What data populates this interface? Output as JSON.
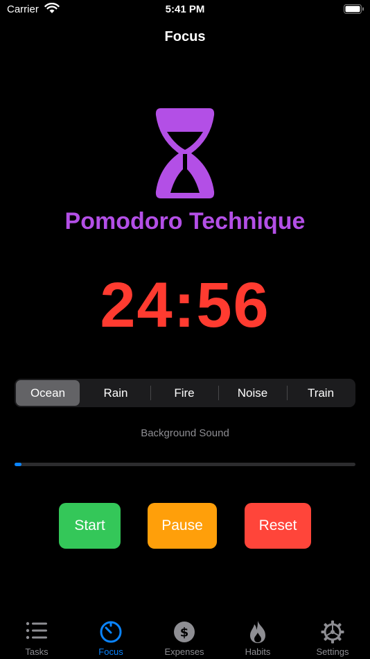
{
  "status_bar": {
    "carrier": "Carrier",
    "time": "5:41 PM"
  },
  "nav": {
    "title": "Focus"
  },
  "main": {
    "icon": "hourglass-icon",
    "technique_title": "Pomodoro Technique",
    "timer": "24:56",
    "sound_segments": [
      "Ocean",
      "Rain",
      "Fire",
      "Noise",
      "Train"
    ],
    "selected_sound": "Ocean",
    "sound_label": "Background Sound",
    "sound_progress": 0.02
  },
  "controls": {
    "start": "Start",
    "pause": "Pause",
    "reset": "Reset"
  },
  "tab_bar": {
    "items": [
      {
        "label": "Tasks",
        "icon": "list-icon",
        "active": false
      },
      {
        "label": "Focus",
        "icon": "timer-icon",
        "active": true
      },
      {
        "label": "Expenses",
        "icon": "dollar-icon",
        "active": false
      },
      {
        "label": "Habits",
        "icon": "flame-icon",
        "active": false
      },
      {
        "label": "Settings",
        "icon": "gear-icon",
        "active": false
      }
    ]
  },
  "colors": {
    "accent": "#0a84ff",
    "technique": "#b34fe6",
    "timer": "#ff3b30",
    "start": "#34c759",
    "pause": "#ff9f0a",
    "reset": "#ff453a"
  }
}
